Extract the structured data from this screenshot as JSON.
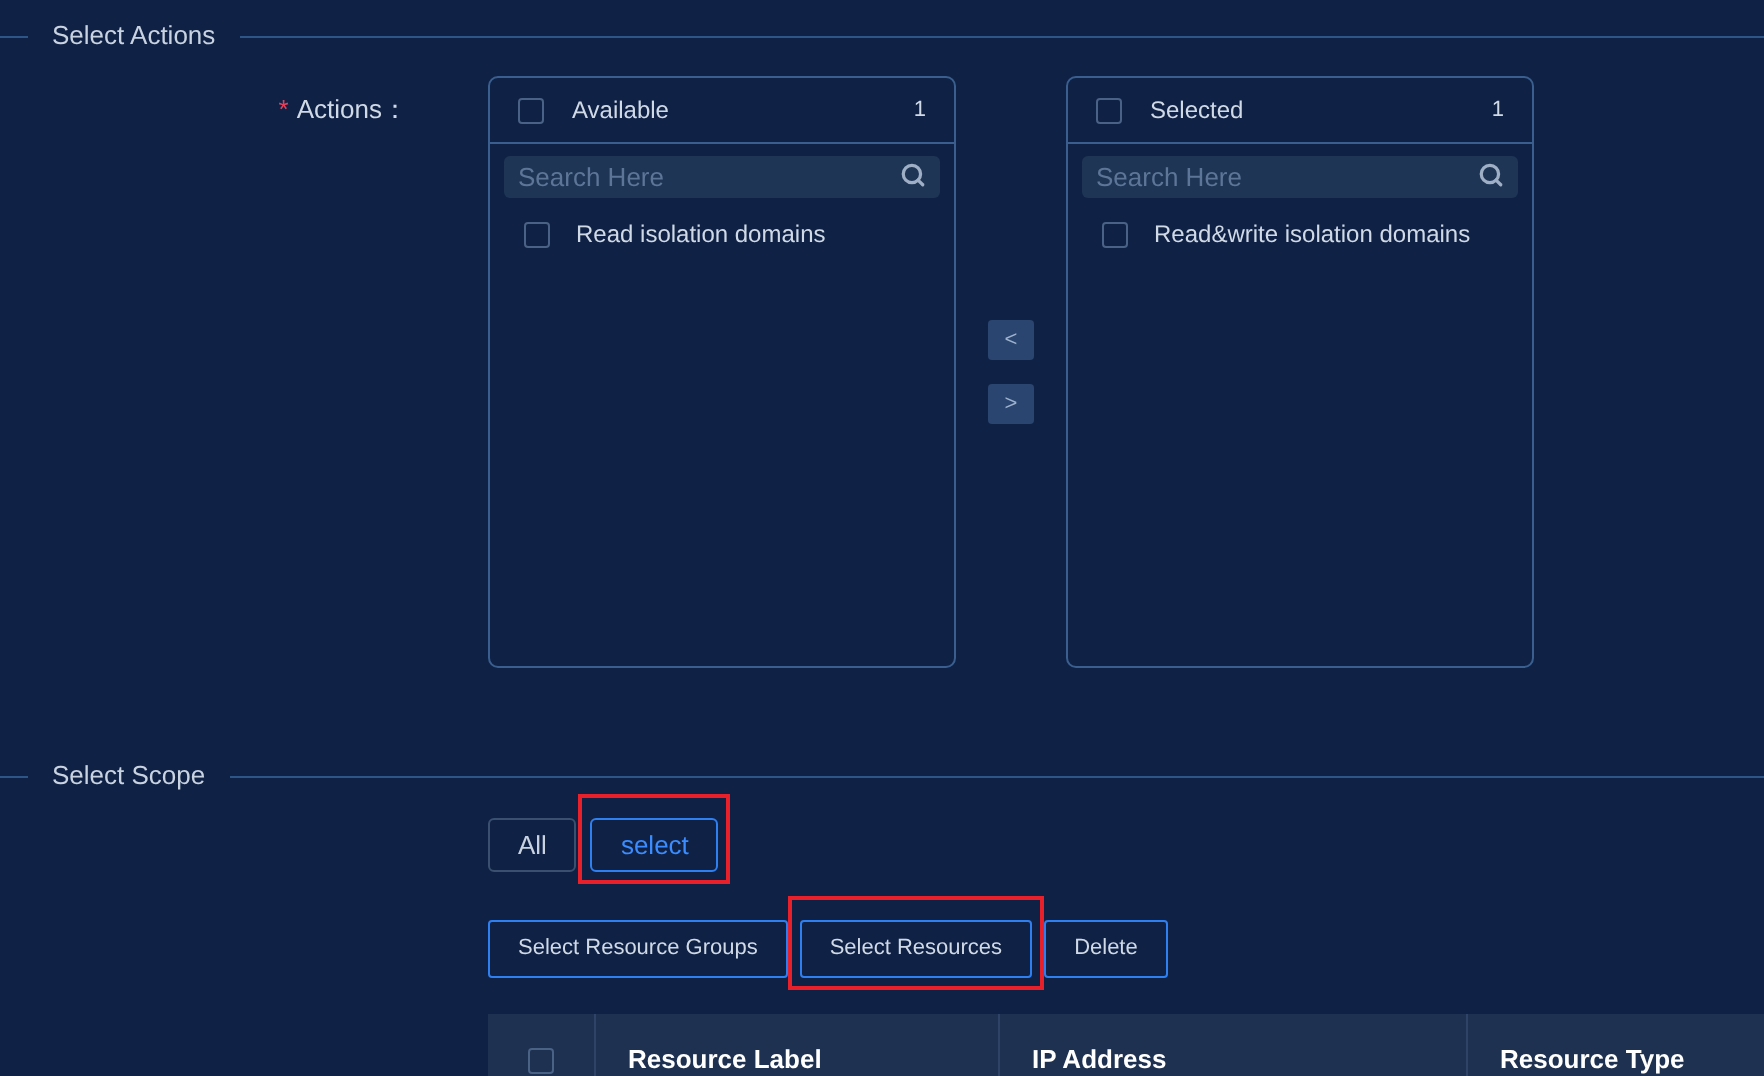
{
  "actions_section": {
    "legend": "Select Actions",
    "field_label": "Actions：",
    "required_mark": "*",
    "lists": [
      {
        "title": "Available",
        "count": "1",
        "checked": false,
        "search_placeholder": "Search Here",
        "items": [
          {
            "label": "Read isolation domains",
            "checked": false
          }
        ]
      },
      {
        "title": "Selected",
        "count": "1",
        "checked": false,
        "search_placeholder": "Search Here",
        "items": [
          {
            "label": "Read&write isolation domains",
            "checked": false
          }
        ]
      }
    ],
    "arrows": [
      "<",
      ">"
    ]
  },
  "scope_section": {
    "legend": "Select Scope",
    "tabs": [
      {
        "label": "All",
        "selected": false,
        "highlighted": false
      },
      {
        "label": "select",
        "selected": true,
        "highlighted": true
      }
    ],
    "buttons": [
      {
        "label": "Select Resource Groups",
        "highlighted": false
      },
      {
        "label": "Select Resources",
        "highlighted": true
      },
      {
        "label": "Delete",
        "highlighted": false
      }
    ],
    "table": {
      "header_checked": false,
      "columns": [
        "Resource Label",
        "IP Address",
        "Resource Type"
      ]
    }
  }
}
